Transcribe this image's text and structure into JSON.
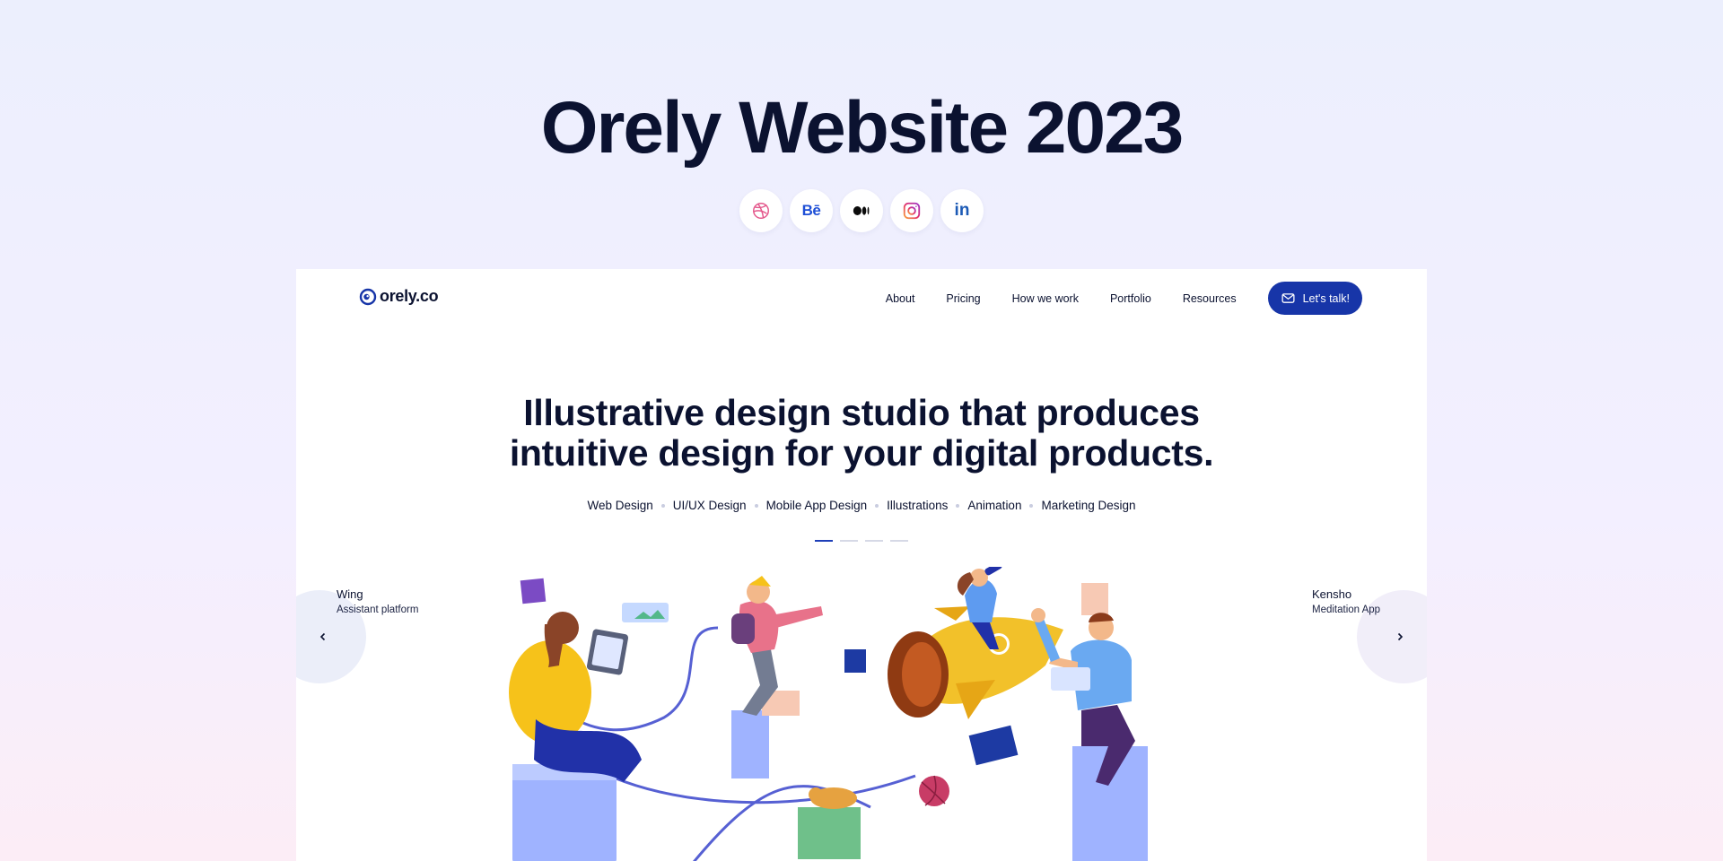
{
  "page": {
    "title": "Orely Website 2023",
    "socials": [
      {
        "name": "dribbble",
        "icon": "dribbble-icon"
      },
      {
        "name": "behance",
        "icon": "behance-icon",
        "label": "Bē"
      },
      {
        "name": "medium",
        "icon": "medium-icon"
      },
      {
        "name": "instagram",
        "icon": "instagram-icon"
      },
      {
        "name": "linkedin",
        "icon": "linkedin-icon",
        "label": "in"
      }
    ]
  },
  "site": {
    "logo": "orely.co",
    "nav": [
      "About",
      "Pricing",
      "How we work",
      "Portfolio",
      "Resources"
    ],
    "cta": "Let's talk!",
    "hero": {
      "line1": "Illustrative design studio that produces",
      "line2": "intuitive design for your digital products."
    },
    "services": [
      "Web Design",
      "UI/UX Design",
      "Mobile App Design",
      "Illustrations",
      "Animation",
      "Marketing Design"
    ],
    "slider": {
      "total": 4,
      "active": 1
    },
    "prev": {
      "title": "Wing",
      "subtitle": "Assistant platform"
    },
    "next": {
      "title": "Kensho",
      "subtitle": "Meditation App"
    }
  },
  "colors": {
    "accent": "#1735a8",
    "text": "#0b1230",
    "background_top": "#eceffd",
    "background_bottom": "#fcedf6"
  }
}
